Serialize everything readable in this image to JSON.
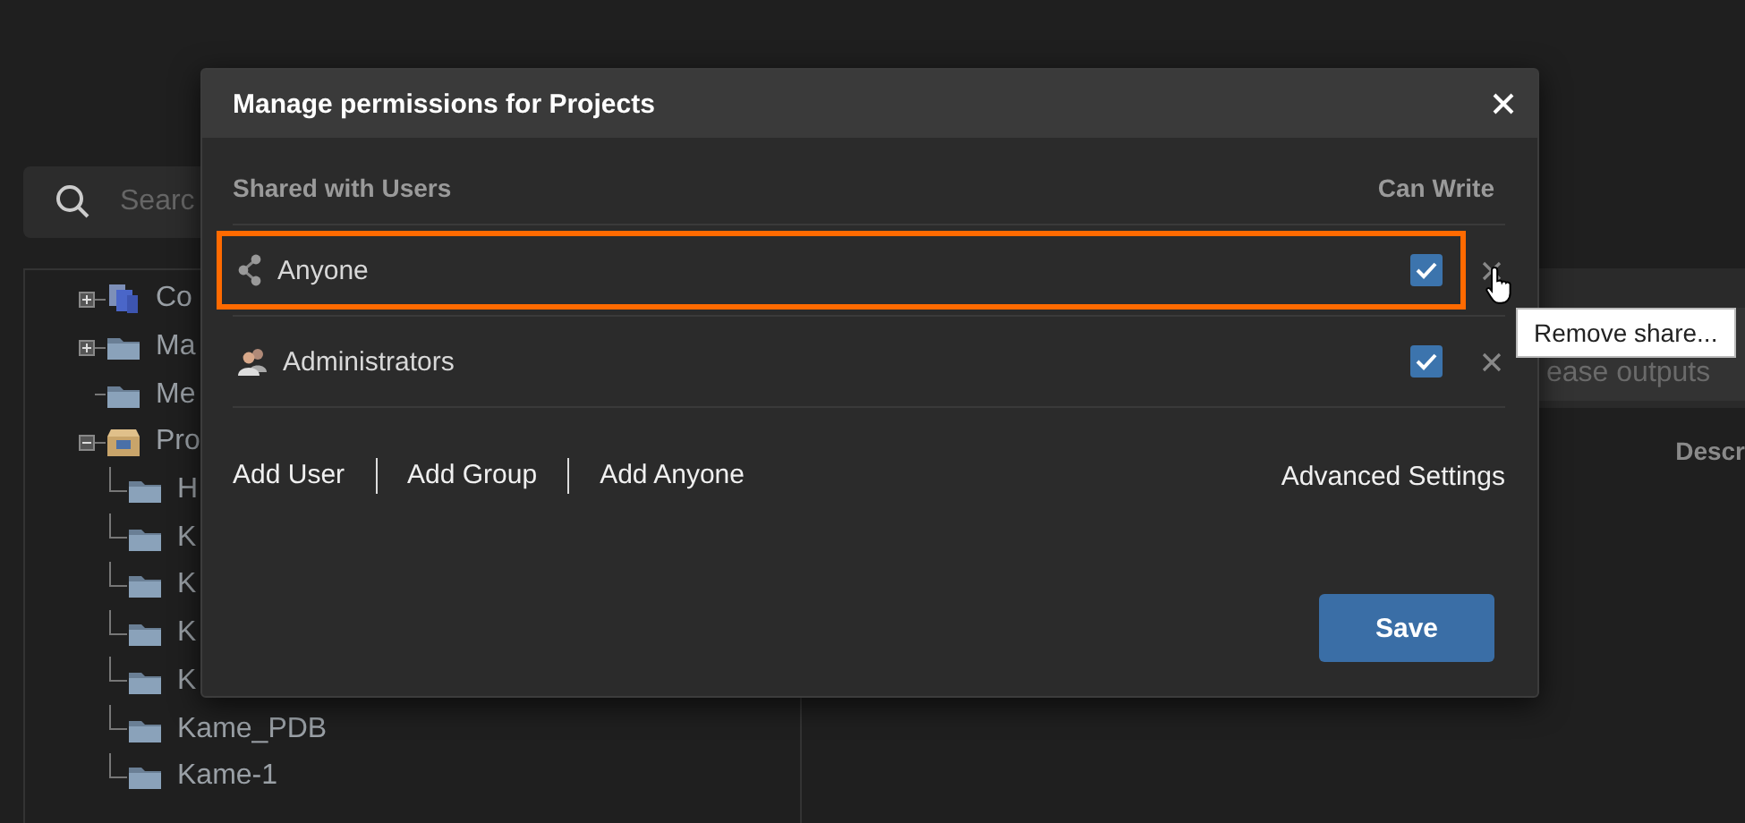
{
  "background": {
    "search": {
      "placeholder": "Searc"
    },
    "tree": [
      {
        "label": "Co",
        "kind": "documents",
        "expanded": false
      },
      {
        "label": "Ma",
        "kind": "folder",
        "expanded": false
      },
      {
        "label": "Me",
        "kind": "folder"
      },
      {
        "label": "Pro",
        "kind": "project",
        "expanded": true,
        "children": [
          {
            "label": "H",
            "kind": "folder"
          },
          {
            "label": "K",
            "kind": "folder"
          },
          {
            "label": "K",
            "kind": "folder"
          },
          {
            "label": "K",
            "kind": "folder"
          },
          {
            "label": "K",
            "kind": "folder"
          },
          {
            "label": "Kame_PDB",
            "kind": "folder"
          },
          {
            "label": "Kame-1",
            "kind": "folder"
          }
        ]
      }
    ],
    "outputs_button": "ease outputs",
    "column_header": "Descr"
  },
  "dialog": {
    "title": "Manage permissions for Projects",
    "columns": [
      "Shared with Users",
      "Can Write"
    ],
    "shares": [
      {
        "name": "Anyone",
        "kind": "public",
        "can_write": true,
        "highlighted": true
      },
      {
        "name": "Administrators",
        "kind": "group",
        "can_write": true,
        "highlighted": false
      }
    ],
    "actions": [
      "Add User",
      "Add Group",
      "Add Anyone"
    ],
    "advanced": "Advanced Settings",
    "save": "Save"
  },
  "tooltip": "Remove share..."
}
